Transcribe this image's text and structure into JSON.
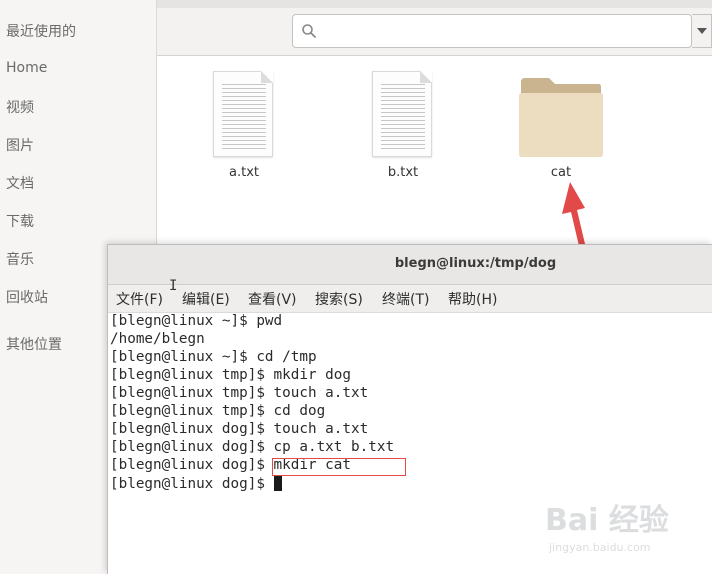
{
  "sidebar": {
    "items": [
      {
        "label": "最近使用的"
      },
      {
        "label": "Home"
      },
      {
        "label": "视频"
      },
      {
        "label": "图片"
      },
      {
        "label": "文档"
      },
      {
        "label": "下载"
      },
      {
        "label": "音乐"
      },
      {
        "label": "回收站"
      },
      {
        "label": "其他位置"
      }
    ]
  },
  "search": {
    "placeholder": "",
    "value": ""
  },
  "files": [
    {
      "name": "a.txt",
      "icon": "text-file-icon"
    },
    {
      "name": "b.txt",
      "icon": "text-file-icon"
    },
    {
      "name": "cat",
      "icon": "folder-icon"
    }
  ],
  "terminal": {
    "title": "blegn@linux:/tmp/dog",
    "menu": [
      "文件(F)",
      "编辑(E)",
      "查看(V)",
      "搜索(S)",
      "终端(T)",
      "帮助(H)"
    ],
    "lines": [
      "[blegn@linux ~]$ pwd",
      "/home/blegn",
      "[blegn@linux ~]$ cd /tmp",
      "[blegn@linux tmp]$ mkdir dog",
      "[blegn@linux tmp]$ touch a.txt",
      "[blegn@linux tmp]$ cd dog",
      "[blegn@linux dog]$ touch a.txt",
      "[blegn@linux dog]$ cp a.txt b.txt",
      "[blegn@linux dog]$ mkdir cat",
      "[blegn@linux dog]$ "
    ]
  },
  "annotation": {
    "highlight_color": "#e24a4a",
    "arrow_color": "#e24a4a"
  },
  "watermark": {
    "main": "Bai 经验",
    "sub": "jingyan.baidu.com"
  },
  "colors": {
    "folder": "#d9c7a6",
    "folder_front": "#ecdcc0",
    "sidebar_bg": "#f6f5f4"
  }
}
